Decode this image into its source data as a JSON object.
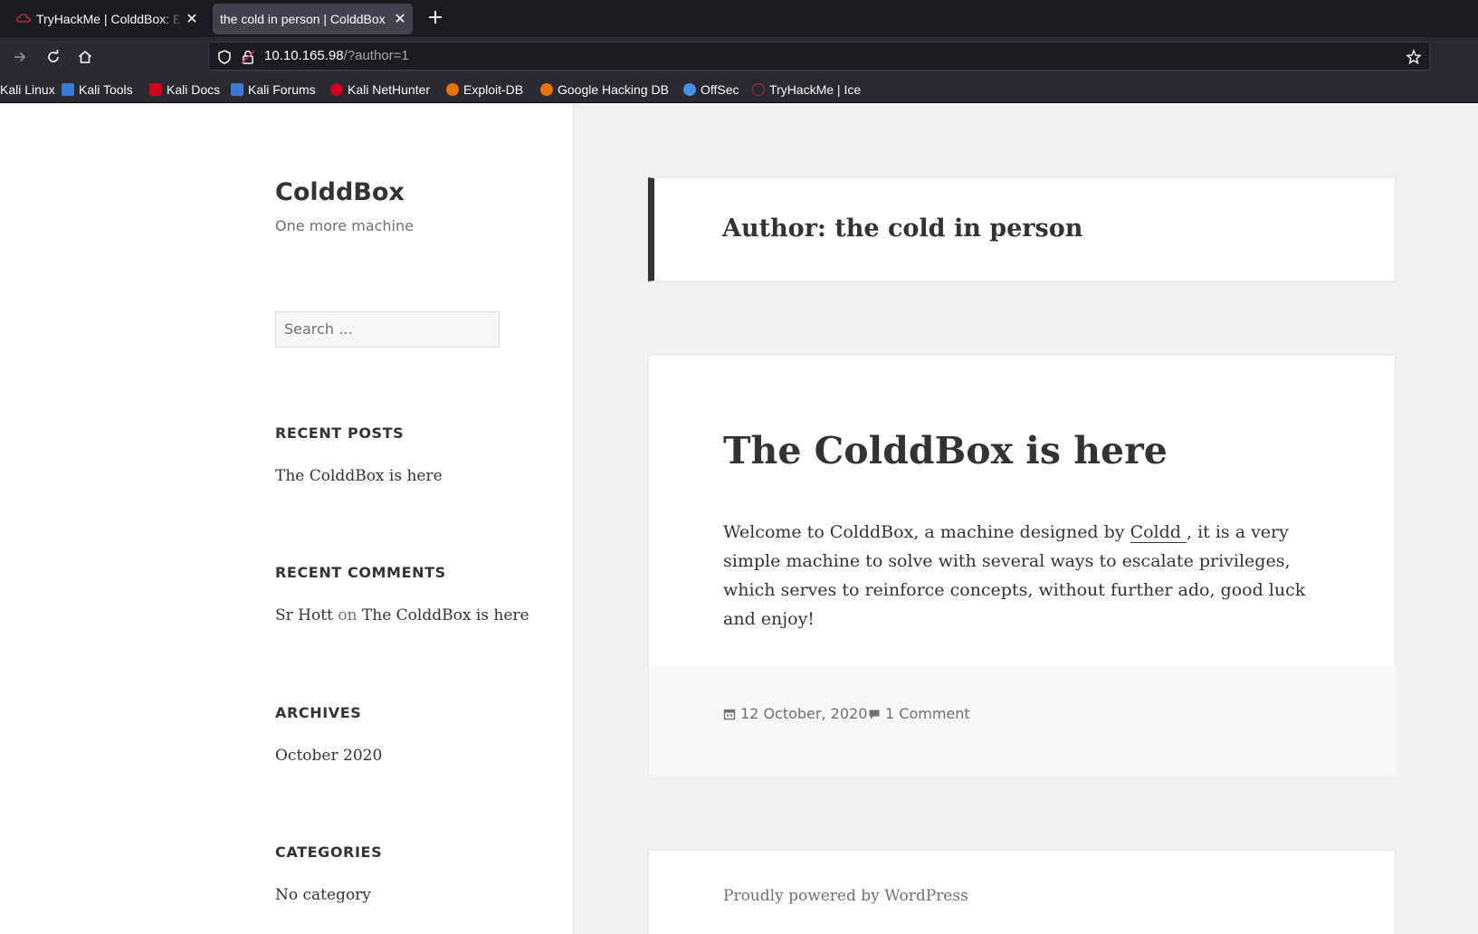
{
  "browser": {
    "tabs": [
      {
        "title": "TryHackMe | ColddBox: Easy",
        "active": false
      },
      {
        "title": "the cold in person | ColddBox",
        "active": true
      }
    ],
    "url_host": "10.10.165.98",
    "url_path": "/?author=1",
    "bookmarks": [
      {
        "label": "Kali Linux",
        "color": "#3a7bd5"
      },
      {
        "label": "Kali Tools",
        "color": "#3a7bd5"
      },
      {
        "label": "Kali Docs",
        "color": "#d0021b"
      },
      {
        "label": "Kali Forums",
        "color": "#3a7bd5"
      },
      {
        "label": "Kali NetHunter",
        "color": "#d0021b"
      },
      {
        "label": "Exploit-DB",
        "color": "#e8710a"
      },
      {
        "label": "Google Hacking DB",
        "color": "#e8710a"
      },
      {
        "label": "OffSec",
        "color": "#4a90e2"
      },
      {
        "label": "TryHackMe | Ice",
        "color": "#c0282d"
      }
    ]
  },
  "site": {
    "title": "ColddBox",
    "description": "One more machine",
    "search_placeholder": "Search …"
  },
  "widgets": {
    "recent_posts": {
      "title": "RECENT POSTS",
      "items": [
        "The ColddBox is here"
      ]
    },
    "recent_comments": {
      "title": "RECENT COMMENTS",
      "author": "Sr Hott",
      "on": "on",
      "post": "The ColddBox is here"
    },
    "archives": {
      "title": "ARCHIVES",
      "items": [
        "October 2020"
      ]
    },
    "categories": {
      "title": "CATEGORIES",
      "items": [
        "No category"
      ]
    }
  },
  "main": {
    "archive_title": "Author: the cold in person",
    "post": {
      "title": "The ColddBox is here",
      "body_before": "Welcome to ColddBox, a machine designed by ",
      "body_link": "Coldd ",
      "body_after": ", it is a very simple machine to solve with several ways to escalate privileges, which serves to reinforce concepts, without further ado, good luck and enjoy!",
      "date": "12 October, 2020",
      "comments": "1 Comment"
    },
    "footer": "Proudly powered by WordPress"
  },
  "colors": {
    "tabbar_bg": "#1c1b22",
    "toolbar_bg": "#2b2a33",
    "text": "#333333",
    "muted": "#707070"
  }
}
